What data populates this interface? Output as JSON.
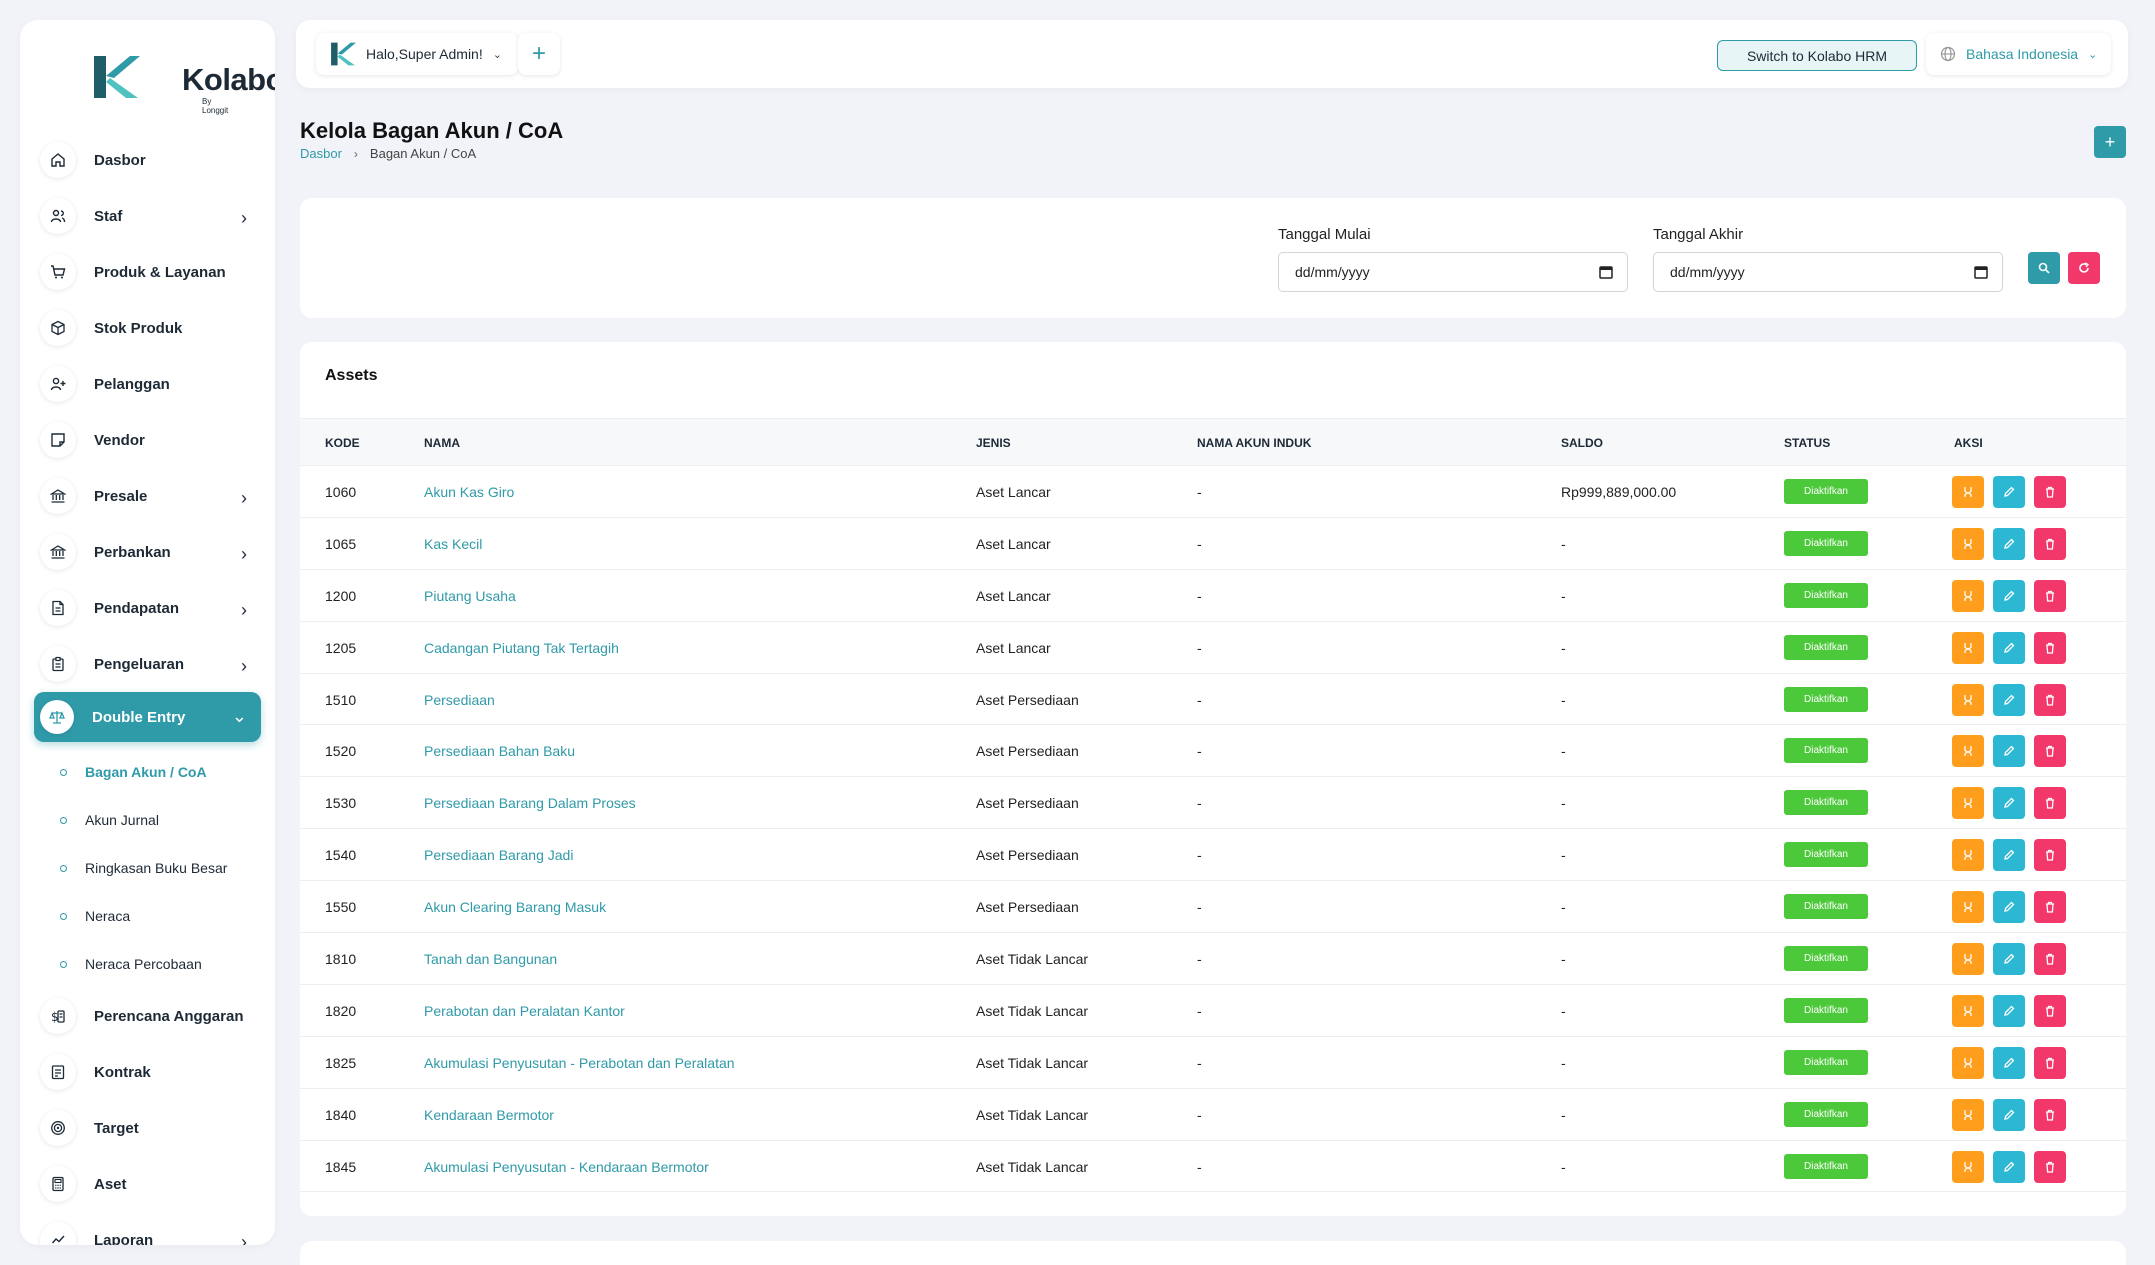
{
  "brand": {
    "name": "Kolabo",
    "sub": "By Longgit"
  },
  "sidebar": {
    "items": [
      {
        "label": "Dasbor",
        "icon": "home-icon",
        "chevron": false
      },
      {
        "label": "Staf",
        "icon": "users-icon",
        "chevron": true
      },
      {
        "label": "Produk & Layanan",
        "icon": "cart-icon",
        "chevron": false
      },
      {
        "label": "Stok Produk",
        "icon": "box-icon",
        "chevron": false
      },
      {
        "label": "Pelanggan",
        "icon": "user-plus-icon",
        "chevron": false
      },
      {
        "label": "Vendor",
        "icon": "note-icon",
        "chevron": false
      },
      {
        "label": "Presale",
        "icon": "bank-icon",
        "chevron": true
      },
      {
        "label": "Perbankan",
        "icon": "bank-icon",
        "chevron": true
      },
      {
        "label": "Pendapatan",
        "icon": "file-icon",
        "chevron": true
      },
      {
        "label": "Pengeluaran",
        "icon": "clipboard-icon",
        "chevron": true
      },
      {
        "label": "Double Entry",
        "icon": "scale-icon",
        "chevron": true,
        "active": true
      }
    ],
    "sub_items": [
      {
        "label": "Bagan Akun / CoA",
        "active": true
      },
      {
        "label": "Akun Jurnal"
      },
      {
        "label": "Ringkasan Buku Besar"
      },
      {
        "label": "Neraca"
      },
      {
        "label": "Neraca Percobaan"
      }
    ],
    "items_after": [
      {
        "label": "Perencana Anggaran",
        "icon": "budget-icon",
        "chevron": false
      },
      {
        "label": "Kontrak",
        "icon": "contract-icon",
        "chevron": false
      },
      {
        "label": "Target",
        "icon": "target-icon",
        "chevron": false
      },
      {
        "label": "Aset",
        "icon": "calculator-icon",
        "chevron": false
      },
      {
        "label": "Laporan",
        "icon": "chart-icon",
        "chevron": true
      }
    ]
  },
  "header": {
    "greeting": "Halo,Super Admin!",
    "switch_label": "Switch to Kolabo HRM",
    "language": "Bahasa Indonesia"
  },
  "page": {
    "title": "Kelola Bagan Akun / CoA",
    "breadcrumb": [
      "Dasbor",
      "Bagan Akun / CoA"
    ]
  },
  "filter": {
    "start_label": "Tanggal Mulai",
    "end_label": "Tanggal Akhir",
    "start_placeholder": "dd/mm/yyyy",
    "end_placeholder": "dd/mm/yyyy"
  },
  "table": {
    "title": "Assets",
    "columns": [
      "KODE",
      "NAMA",
      "JENIS",
      "NAMA AKUN INDUK",
      "SALDO",
      "STATUS",
      "AKSI"
    ],
    "rows": [
      {
        "kode": "1060",
        "nama": "Akun Kas Giro",
        "jenis": "Aset Lancar",
        "induk": "-",
        "saldo": "Rp999,889,000.00",
        "status": "Diaktifkan"
      },
      {
        "kode": "1065",
        "nama": "Kas Kecil",
        "jenis": "Aset Lancar",
        "induk": "-",
        "saldo": "-",
        "status": "Diaktifkan"
      },
      {
        "kode": "1200",
        "nama": "Piutang Usaha",
        "jenis": "Aset Lancar",
        "induk": "-",
        "saldo": "-",
        "status": "Diaktifkan"
      },
      {
        "kode": "1205",
        "nama": "Cadangan Piutang Tak Tertagih",
        "jenis": "Aset Lancar",
        "induk": "-",
        "saldo": "-",
        "status": "Diaktifkan"
      },
      {
        "kode": "1510",
        "nama": "Persediaan",
        "jenis": "Aset Persediaan",
        "induk": "-",
        "saldo": "-",
        "status": "Diaktifkan"
      },
      {
        "kode": "1520",
        "nama": "Persediaan Bahan Baku",
        "jenis": "Aset Persediaan",
        "induk": "-",
        "saldo": "-",
        "status": "Diaktifkan"
      },
      {
        "kode": "1530",
        "nama": "Persediaan Barang Dalam Proses",
        "jenis": "Aset Persediaan",
        "induk": "-",
        "saldo": "-",
        "status": "Diaktifkan"
      },
      {
        "kode": "1540",
        "nama": "Persediaan Barang Jadi",
        "jenis": "Aset Persediaan",
        "induk": "-",
        "saldo": "-",
        "status": "Diaktifkan"
      },
      {
        "kode": "1550",
        "nama": "Akun Clearing Barang Masuk",
        "jenis": "Aset Persediaan",
        "induk": "-",
        "saldo": "-",
        "status": "Diaktifkan"
      },
      {
        "kode": "1810",
        "nama": "Tanah dan Bangunan",
        "jenis": "Aset Tidak Lancar",
        "induk": "-",
        "saldo": "-",
        "status": "Diaktifkan"
      },
      {
        "kode": "1820",
        "nama": "Perabotan dan Peralatan Kantor",
        "jenis": "Aset Tidak Lancar",
        "induk": "-",
        "saldo": "-",
        "status": "Diaktifkan"
      },
      {
        "kode": "1825",
        "nama": "Akumulasi Penyusutan - Perabotan dan Peralatan",
        "jenis": "Aset Tidak Lancar",
        "induk": "-",
        "saldo": "-",
        "status": "Diaktifkan"
      },
      {
        "kode": "1840",
        "nama": "Kendaraan Bermotor",
        "jenis": "Aset Tidak Lancar",
        "induk": "-",
        "saldo": "-",
        "status": "Diaktifkan"
      },
      {
        "kode": "1845",
        "nama": "Akumulasi Penyusutan - Kendaraan Bermotor",
        "jenis": "Aset Tidak Lancar",
        "induk": "-",
        "saldo": "-",
        "status": "Diaktifkan"
      }
    ]
  },
  "colors": {
    "accent": "#2f9aa8",
    "danger": "#f2386a",
    "warning": "#ff9d1c",
    "info": "#2cb7d2",
    "success": "#4cc93a"
  }
}
